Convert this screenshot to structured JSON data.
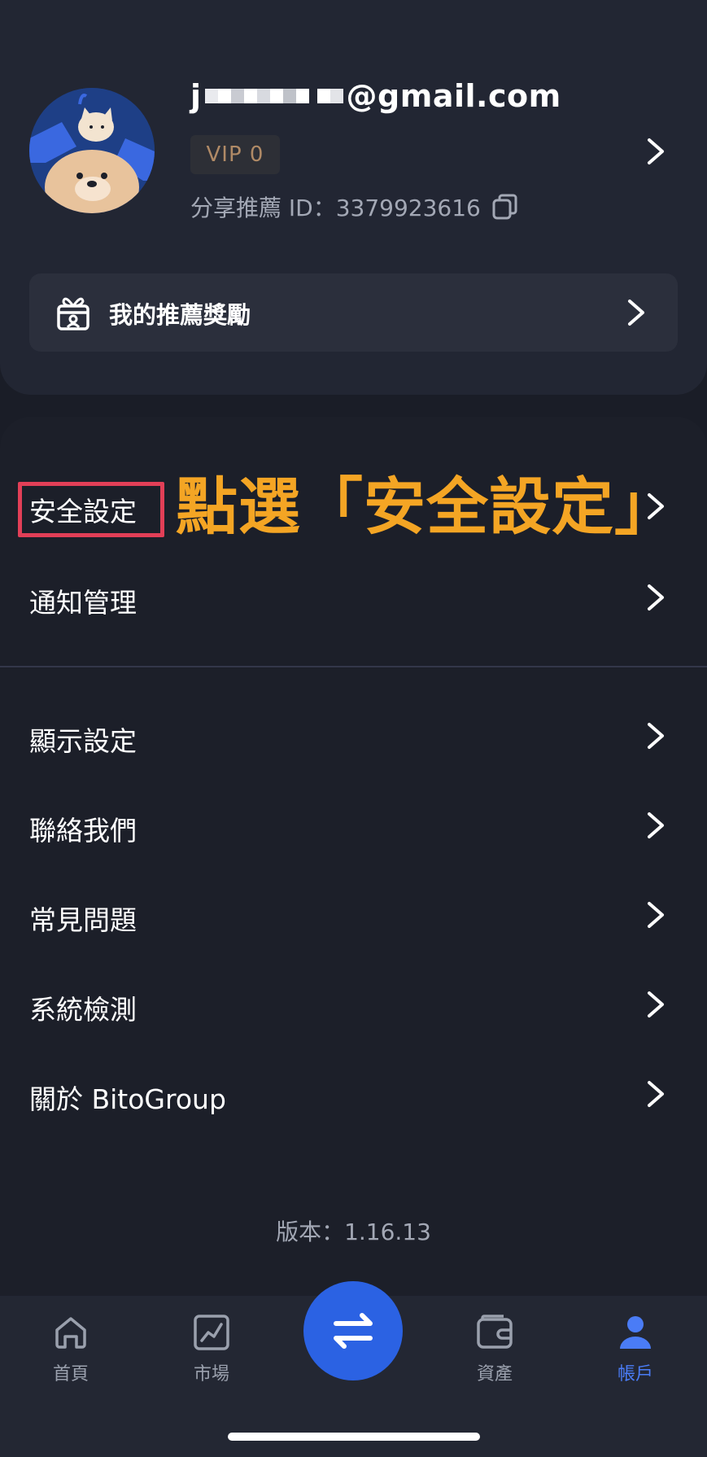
{
  "profile": {
    "email_prefix": "j",
    "email_domain": "@gmail.com",
    "vip_label": "VIP 0",
    "referral_label": "分享推薦 ID：3379923616",
    "colors": {
      "avatar_bg": "#1e3f86",
      "vip_text": "#b08a66"
    }
  },
  "rewards": {
    "label": "我的推薦獎勵",
    "icon": "gift-icon"
  },
  "menu": {
    "items": [
      {
        "label": "安全設定"
      },
      {
        "label": "通知管理"
      },
      {
        "label": "顯示設定"
      },
      {
        "label": "聯絡我們"
      },
      {
        "label": "常見問題"
      },
      {
        "label": "系統檢測"
      },
      {
        "label": "關於 BitoGroup"
      }
    ]
  },
  "annotation": {
    "text": "點選「安全設定」",
    "color": "#f4a524",
    "highlight_color": "#e23f57"
  },
  "version": "版本：1.16.13",
  "bottom_nav": {
    "items": [
      {
        "label": "首頁",
        "icon": "home-icon"
      },
      {
        "label": "市場",
        "icon": "chart-icon"
      },
      {
        "label": "資產",
        "icon": "wallet-icon"
      },
      {
        "label": "帳戶",
        "icon": "account-icon",
        "active": true
      }
    ],
    "swap_icon": "swap-arrows-icon",
    "accent": "#2b62e3"
  }
}
